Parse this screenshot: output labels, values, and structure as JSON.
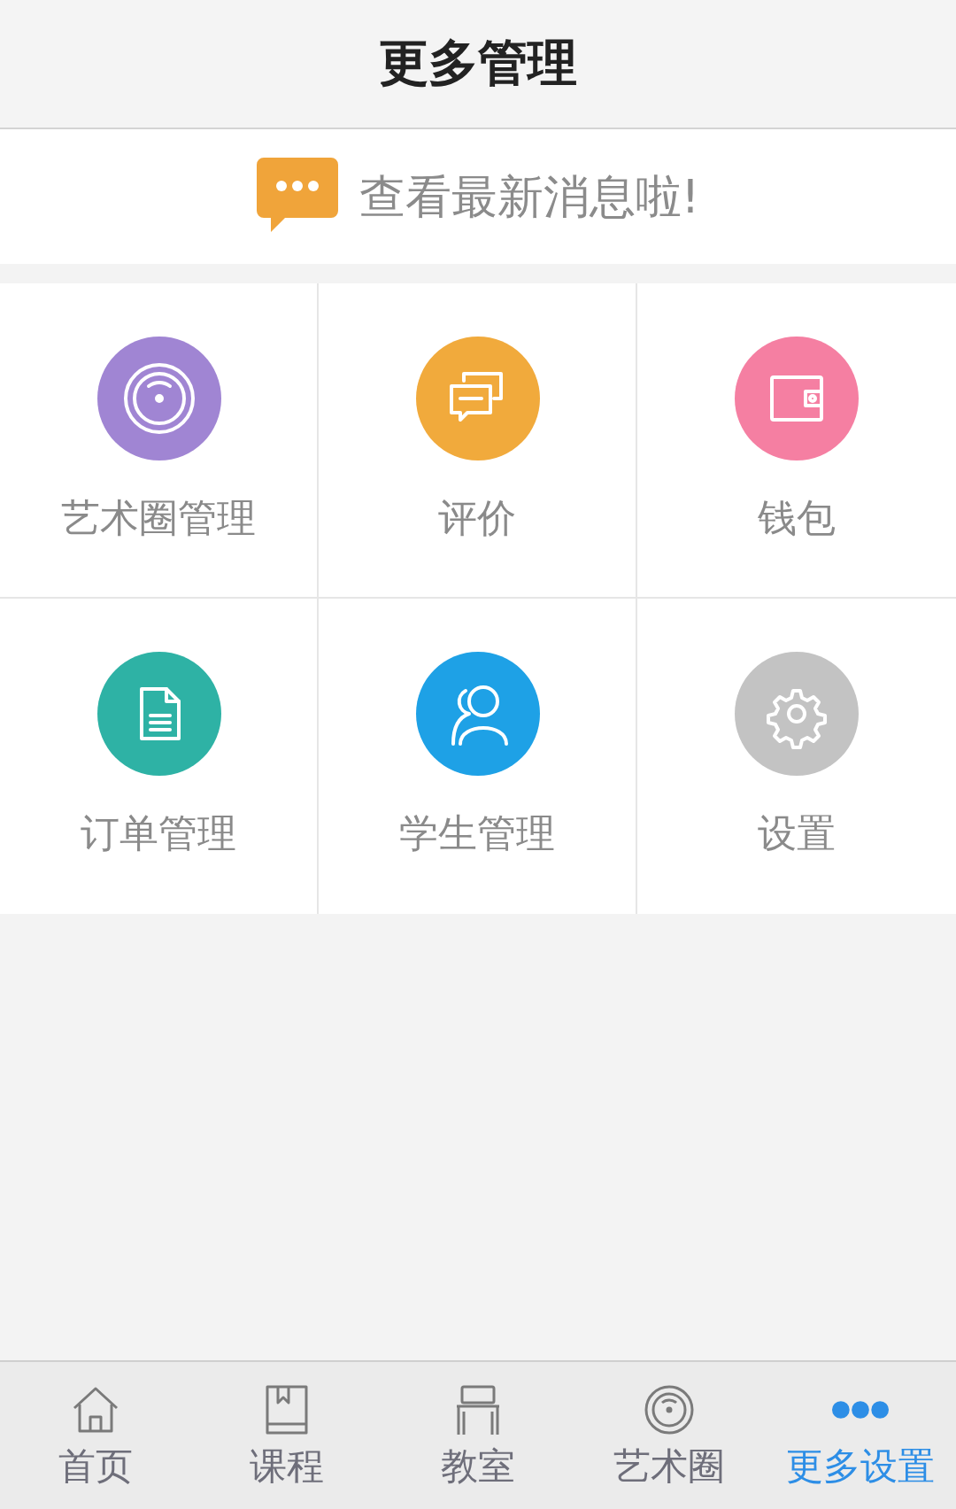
{
  "header": {
    "title": "更多管理"
  },
  "notice": {
    "text": "查看最新消息啦!"
  },
  "tiles": [
    {
      "label": "艺术圈管理",
      "kind": "circle",
      "color": "#a085d3"
    },
    {
      "label": "评价",
      "kind": "chat",
      "color": "#f1aa3c"
    },
    {
      "label": "钱包",
      "kind": "wallet",
      "color": "#f57fa2"
    },
    {
      "label": "订单管理",
      "kind": "document",
      "color": "#2eb2a5"
    },
    {
      "label": "学生管理",
      "kind": "people",
      "color": "#1ea1e6"
    },
    {
      "label": "设置",
      "kind": "gear",
      "color": "#c3c3c3"
    }
  ],
  "tab_bar": [
    {
      "label": "首页",
      "kind": "home",
      "selected": false
    },
    {
      "label": "课程",
      "kind": "book",
      "selected": false
    },
    {
      "label": "教室",
      "kind": "chair",
      "selected": false
    },
    {
      "label": "艺术圈",
      "kind": "circle",
      "selected": false
    },
    {
      "label": "更多设置",
      "kind": "dots",
      "selected": true
    }
  ]
}
